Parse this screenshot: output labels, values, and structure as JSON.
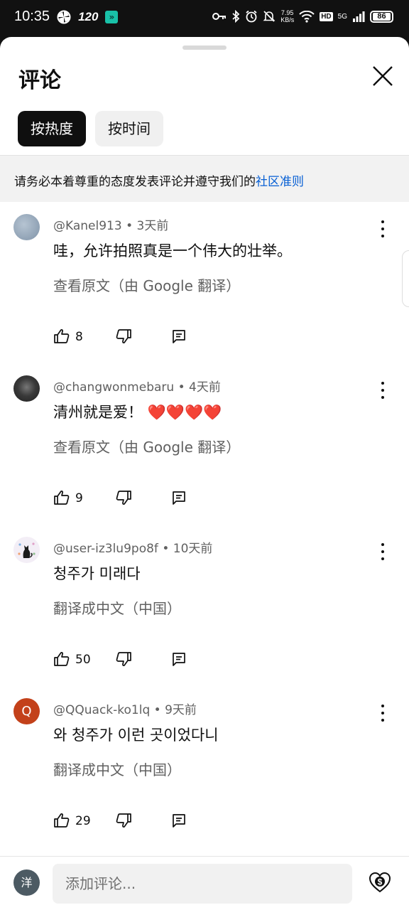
{
  "status_bar": {
    "time": "10:35",
    "refresh_rate": "120",
    "speed": "7.95",
    "speed_unit": "KB/s",
    "hd": "HD",
    "network": "5G",
    "battery": "86"
  },
  "header": {
    "title": "评论",
    "close_icon": "close-icon"
  },
  "sort_chips": [
    {
      "label": "按热度",
      "active": true
    },
    {
      "label": "按时间",
      "active": false
    }
  ],
  "notice": {
    "text": "请务必本着尊重的态度发表评论并遵守我们的",
    "link": "社区准则"
  },
  "comments": [
    {
      "author": "@Kanel913",
      "time": "3天前",
      "text": "哇，允许拍照真是一个伟大的壮举。",
      "translate_label": "查看原文（由 Google 翻译）",
      "likes": "8",
      "avatar_color": "#8ea1b6"
    },
    {
      "author": "@changwonmebaru",
      "time": "4天前",
      "text": "清州就是爱！ ❤️❤️❤️❤️",
      "translate_label": "查看原文（由 Google 翻译）",
      "likes": "9",
      "avatar_color": "#2b2b2b"
    },
    {
      "author": "@user-iz3lu9po8f",
      "time": "10天前",
      "text": "청주가 미래다",
      "translate_label": "翻译成中文（中国）",
      "likes": "50",
      "avatar_color": "#f3eef6"
    },
    {
      "author": "@QQuack-ko1lq",
      "time": "9天前",
      "text": "와 청주가 이런 곳이었다니",
      "translate_label": "翻译成中文（中国）",
      "likes": "29",
      "avatar_color": "#c3411a",
      "avatar_letter": "Q"
    }
  ],
  "composer": {
    "avatar_letter": "洋",
    "placeholder": "添加评论..."
  },
  "separator": "•"
}
